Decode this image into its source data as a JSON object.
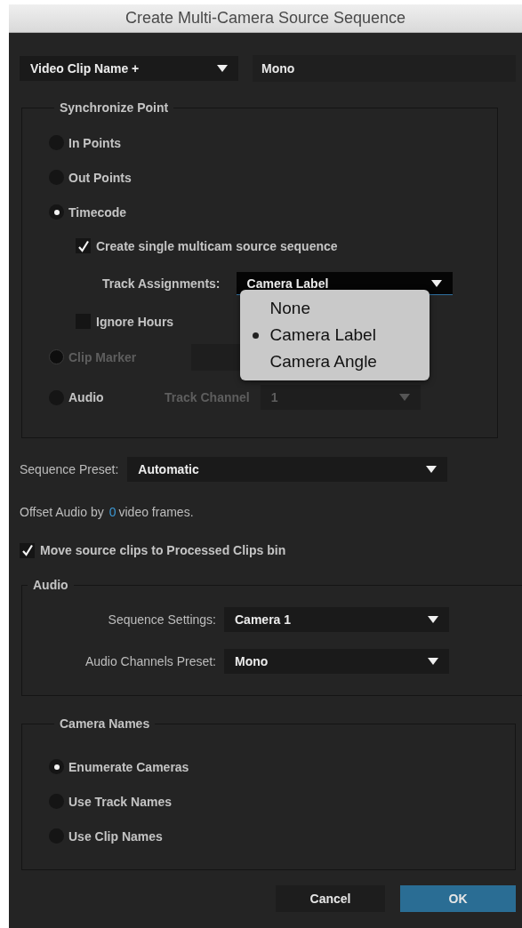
{
  "window": {
    "title": "Create Multi-Camera Source Sequence"
  },
  "name_source": {
    "value": "Video Clip Name +"
  },
  "name_field": {
    "value": "Mono"
  },
  "sync_point": {
    "legend": "Synchronize Point",
    "options": [
      {
        "kind": "radio",
        "label": "In Points",
        "selected": false,
        "disabled": false
      },
      {
        "kind": "radio",
        "label": "Out Points",
        "selected": false,
        "disabled": false
      },
      {
        "kind": "radio",
        "label": "Timecode",
        "selected": true,
        "disabled": false,
        "children": [
          {
            "kind": "checkbox",
            "label": "Create single multicam source sequence",
            "checked": true
          },
          {
            "kind": "select",
            "label": "Track Assignments:",
            "value": "Camera Label",
            "expanded": true,
            "options": [
              {
                "label": "None",
                "selected": false
              },
              {
                "label": "Camera Label",
                "selected": true
              },
              {
                "label": "Camera Angle",
                "selected": false
              }
            ]
          },
          {
            "kind": "checkbox",
            "label": "Ignore Hours",
            "checked": false
          }
        ]
      },
      {
        "kind": "radio",
        "label": "Clip Marker",
        "selected": false,
        "disabled": true,
        "field": {
          "disabled": true
        }
      },
      {
        "kind": "radio",
        "label": "Audio",
        "selected": false,
        "disabled": false,
        "select": {
          "label": "Track Channel",
          "value": "1",
          "disabled": true
        }
      }
    ]
  },
  "sequence_preset": {
    "label": "Sequence Preset:",
    "value": "Automatic"
  },
  "offset_audio": {
    "prefix": "Offset Audio by",
    "value": "0",
    "suffix": "video frames."
  },
  "move_source_clips": {
    "label": "Move source clips to Processed Clips bin",
    "checked": true
  },
  "audio": {
    "legend": "Audio",
    "fields": [
      {
        "label": "Sequence Settings:",
        "value": "Camera 1"
      },
      {
        "label": "Audio Channels Preset:",
        "value": "Mono"
      }
    ]
  },
  "camera_names": {
    "legend": "Camera Names",
    "options": [
      {
        "label": "Enumerate Cameras",
        "selected": true
      },
      {
        "label": "Use Track Names",
        "selected": false
      },
      {
        "label": "Use Clip Names",
        "selected": false
      }
    ]
  },
  "buttons": [
    {
      "label": "Cancel",
      "kind": "secondary"
    },
    {
      "label": "OK",
      "kind": "primary"
    }
  ]
}
